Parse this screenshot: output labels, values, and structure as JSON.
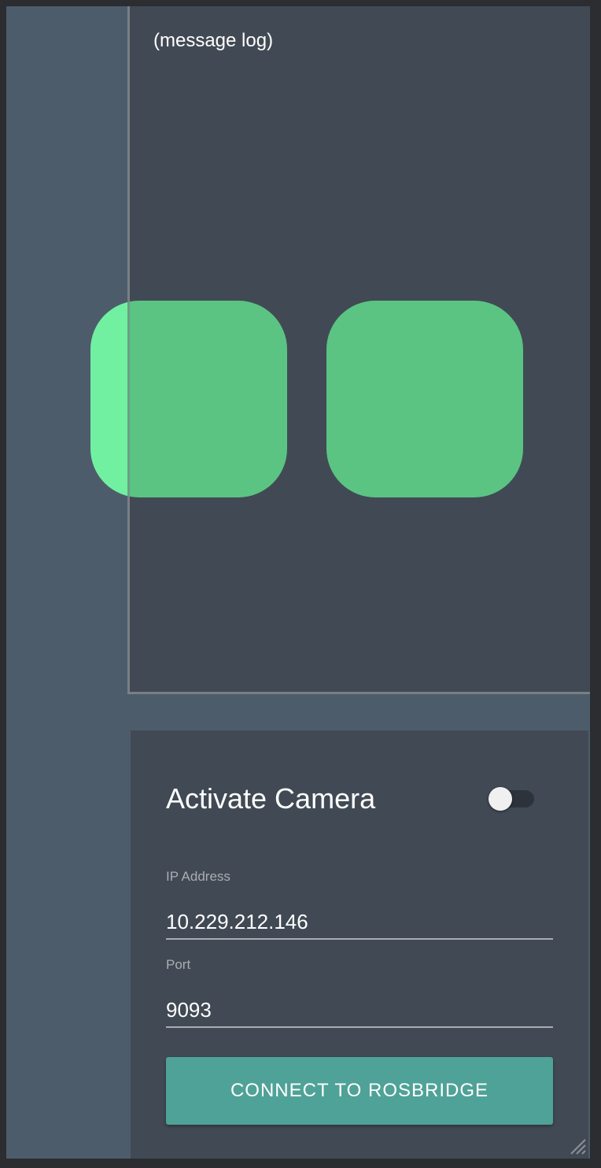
{
  "log": {
    "text": "(message log)"
  },
  "pads": [
    {
      "name": "left-pad",
      "color": "#5bc483"
    },
    {
      "name": "right-pad",
      "color": "#5bc483"
    }
  ],
  "camera": {
    "label": "Activate Camera",
    "enabled": false
  },
  "ip": {
    "label": "IP Address",
    "value": "10.229.212.146"
  },
  "port": {
    "label": "Port",
    "value": "9093"
  },
  "connect": {
    "label": "CONNECT TO ROSBRIDGE"
  },
  "colors": {
    "accent": "#4fa297",
    "pad": "#5bc483",
    "panel": "#414a54",
    "background": "#4d5c6b"
  }
}
